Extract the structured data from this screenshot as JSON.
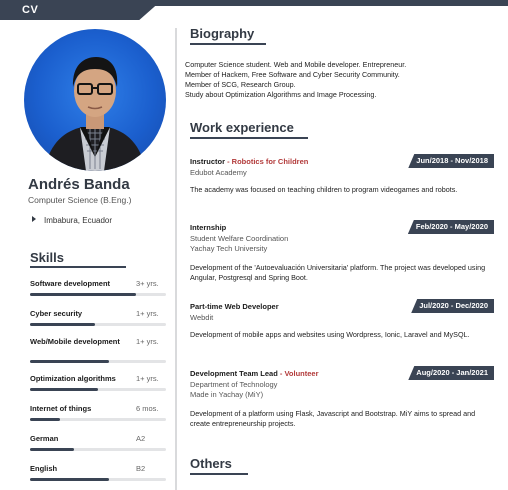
{
  "header": {
    "tab_label": "CV"
  },
  "sidebar": {
    "name": "Andrés Banda",
    "degree": "Computer Science (B.Eng.)",
    "location": "Imbabura, Ecuador",
    "skills_title": "Skills",
    "skills": [
      {
        "name": "Software development",
        "level": "3+ yrs.",
        "proficiency": 0.78
      },
      {
        "name": "Cyber security",
        "level": "1+ yrs.",
        "proficiency": 0.48
      },
      {
        "name": "Web/Mobile development",
        "level": "1+ yrs.",
        "proficiency": 0.58
      },
      {
        "name": "Optimization algorithms",
        "level": "1+ yrs.",
        "proficiency": 0.5
      },
      {
        "name": "Internet of things",
        "level": "6 mos.",
        "proficiency": 0.22
      },
      {
        "name": "German",
        "level": "A2",
        "proficiency": 0.32
      },
      {
        "name": "English",
        "level": "B2",
        "proficiency": 0.58
      }
    ]
  },
  "main": {
    "biography_title": "Biography",
    "biography_lines": [
      "Computer Science student. Web and Mobile developer. Entrepreneur.",
      "Member of Hackem, Free Software and Cyber Security Community.",
      "Member of SCG, Research Group.",
      "Study about Optimization Algorithms and Image Processing."
    ],
    "work_title": "Work experience",
    "jobs": [
      {
        "title": "Instructor",
        "subtitle": " - Robotics for Children",
        "date": "Jun/2018 - Nov/2018",
        "org_lines": [
          "Edubot Academy"
        ],
        "description": "The academy was focused on teaching children to program videogames and robots."
      },
      {
        "title": "Internship",
        "subtitle": "",
        "date": "Feb/2020 - May/2020",
        "org_lines": [
          "Student Welfare Coordination",
          "Yachay Tech University"
        ],
        "description": "Development of the 'Autoevaluación Universitaria' platform. The project was developed using Angular, Postgresql and Spring Boot."
      },
      {
        "title": "Part-time Web Developer",
        "subtitle": "",
        "date": "Jul/2020 - Dec/2020",
        "org_lines": [
          "Webdit"
        ],
        "description": "Development of mobile apps and websites using Wordpress, Ionic, Laravel and MySQL."
      },
      {
        "title": "Development Team Lead",
        "subtitle": " - Volunteer",
        "date": "Aug/2020 - Jan/2021",
        "org_lines": [
          "Department of Technology",
          "Made in Yachay (MiY)"
        ],
        "description": "Development of a platform using Flask, Javascript and Bootstrap. MiY aims to spread and create entrepreneurship projects."
      }
    ],
    "others_title": "Others"
  },
  "colors": {
    "accent": "#3a4454",
    "track": "#e3e4e6",
    "subtitle_red": "#b23a3a",
    "photo_bg": "#1b5fce"
  }
}
